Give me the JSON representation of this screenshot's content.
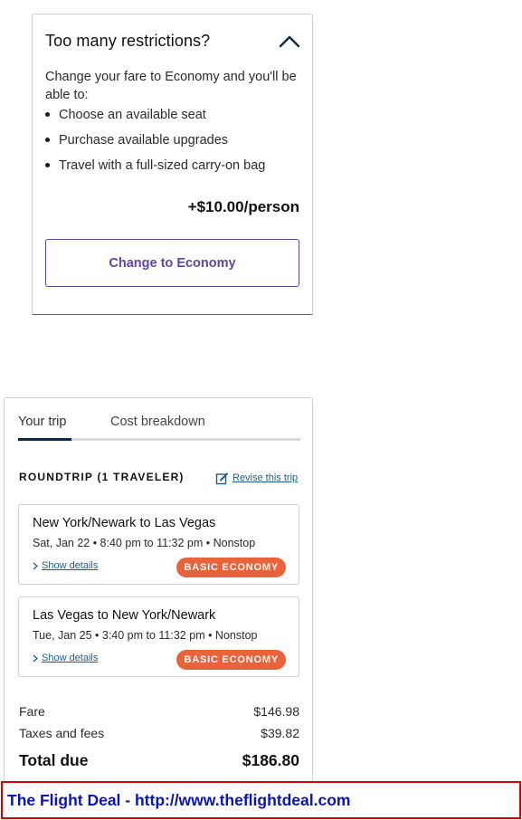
{
  "restrictions": {
    "title": "Too many restrictions?",
    "description": "Change your fare to Economy and you'll be able to:",
    "benefits": [
      "Choose an available seat",
      "Purchase available upgrades",
      "Travel with a full-sized carry-on bag"
    ],
    "price": "+$10.00/person",
    "cta_label": "Change to Economy",
    "accent_color": "#6244a6"
  },
  "trip": {
    "tabs": [
      "Your trip",
      "Cost breakdown"
    ],
    "active_tab": "Your trip",
    "heading": "ROUNDTRIP (1 TRAVELER)",
    "revise_label": "Revise this trip",
    "flights": [
      {
        "route": "New York/Newark to Las Vegas",
        "times": "Sat, Jan 22 • 8:40 pm to 11:32 pm • Nonstop",
        "details_label": "Show details",
        "fare_class": "BASIC ECONOMY"
      },
      {
        "route": "Las Vegas to New York/Newark",
        "times": "Tue, Jan 25 • 3:40 pm to 11:32 pm • Nonstop",
        "details_label": "Show details",
        "fare_class": "BASIC ECONOMY"
      }
    ],
    "summary": {
      "fare_label": "Fare",
      "fare_value": "$146.98",
      "taxes_label": "Taxes and fees",
      "taxes_value": "$39.82",
      "total_label": "Total due",
      "total_value": "$186.80"
    },
    "badge_color": "#e9633a",
    "tab_indicator_color": "#0b2a48"
  },
  "banner": {
    "text": "The Flight Deal - http://www.theflightdeal.com",
    "border_color": "#e00000",
    "text_color": "#0a14b8"
  }
}
